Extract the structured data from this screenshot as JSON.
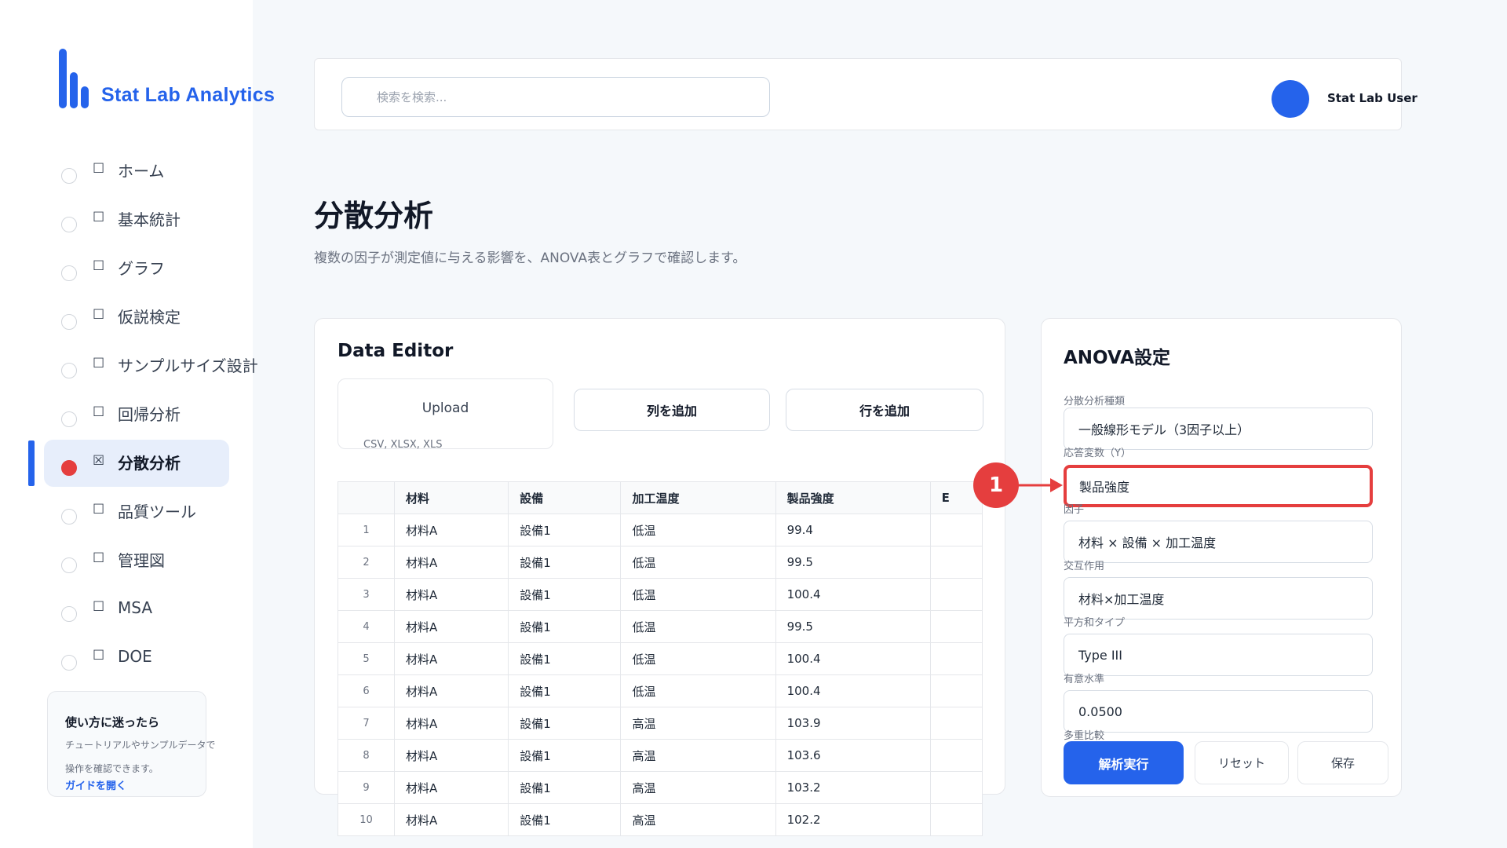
{
  "app": {
    "name": "Stat Lab Analytics"
  },
  "sidebar": {
    "items": [
      {
        "glyph": "☐",
        "label": "ホーム"
      },
      {
        "glyph": "☐",
        "label": "基本統計"
      },
      {
        "glyph": "☐",
        "label": "グラフ"
      },
      {
        "glyph": "☐",
        "label": "仮説検定"
      },
      {
        "glyph": "☐",
        "label": "サンプルサイズ設計"
      },
      {
        "glyph": "☐",
        "label": "回帰分析"
      },
      {
        "glyph": "☒",
        "label": "分散分析"
      },
      {
        "glyph": "☐",
        "label": "品質ツール"
      },
      {
        "glyph": "☐",
        "label": "管理図"
      },
      {
        "glyph": "☐",
        "label": "MSA"
      },
      {
        "glyph": "☐",
        "label": "DOE"
      }
    ],
    "active_index": 6,
    "help": {
      "title": "使い方に迷ったら",
      "desc": "チュートリアルやサンプルデータで操作を確認できます。",
      "link": "ガイドを開く"
    }
  },
  "header": {
    "search_placeholder": "検索を検索...",
    "user_name": "Stat Lab User"
  },
  "page": {
    "title": "分散分析",
    "subtitle": "複数の因子が測定値に与える影響を、ANOVA表とグラフで確認します。"
  },
  "editor": {
    "title": "Data Editor",
    "upload_label": "Upload",
    "upload_formats": "CSV, XLSX, XLS",
    "add_column": "列を追加",
    "add_row": "行を追加",
    "columns": [
      "",
      "材料",
      "設備",
      "加工温度",
      "製品強度",
      "E"
    ],
    "rows": [
      [
        "1",
        "材料A",
        "設備1",
        "低温",
        "99.4",
        ""
      ],
      [
        "2",
        "材料A",
        "設備1",
        "低温",
        "99.5",
        ""
      ],
      [
        "3",
        "材料A",
        "設備1",
        "低温",
        "100.4",
        ""
      ],
      [
        "4",
        "材料A",
        "設備1",
        "低温",
        "99.5",
        ""
      ],
      [
        "5",
        "材料A",
        "設備1",
        "低温",
        "100.4",
        ""
      ],
      [
        "6",
        "材料A",
        "設備1",
        "低温",
        "100.4",
        ""
      ],
      [
        "7",
        "材料A",
        "設備1",
        "高温",
        "103.9",
        ""
      ],
      [
        "8",
        "材料A",
        "設備1",
        "高温",
        "103.6",
        ""
      ],
      [
        "9",
        "材料A",
        "設備1",
        "高温",
        "103.2",
        ""
      ],
      [
        "10",
        "材料A",
        "設備1",
        "高温",
        "102.2",
        ""
      ]
    ]
  },
  "settings": {
    "title": "ANOVA設定",
    "fields": [
      {
        "label": "分散分析種類",
        "value": "一般線形モデル（3因子以上）"
      },
      {
        "label": "応答変数（Y）",
        "value": "製品強度"
      },
      {
        "label": "因子",
        "value": "材料 × 設備 × 加工温度"
      },
      {
        "label": "交互作用",
        "value": "材料×加工温度"
      },
      {
        "label": "平方和タイプ",
        "value": "Type III"
      },
      {
        "label": "有意水準",
        "value": "0.0500"
      },
      {
        "label": "多重比較",
        "value": ""
      }
    ],
    "run_label": "解析実行",
    "reset_label": "リセット",
    "save_label": "保存"
  },
  "annotation": {
    "callout_number": "1"
  },
  "colors": {
    "accent": "#2563eb",
    "highlight": "#e53e3e"
  }
}
